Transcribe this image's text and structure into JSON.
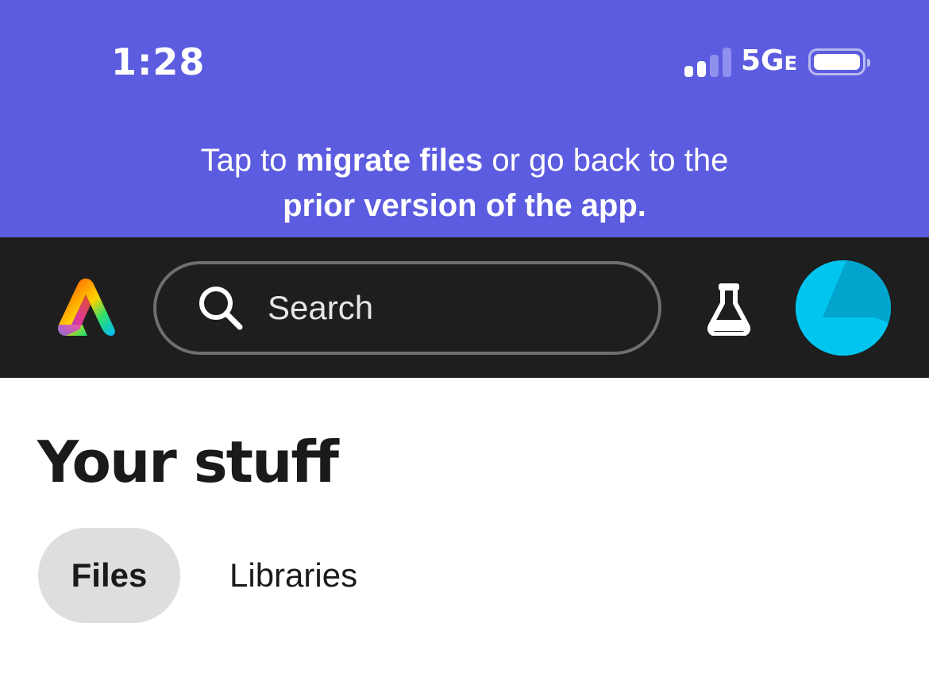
{
  "status_bar": {
    "time": "1:28",
    "network": "5G",
    "network_suffix": "E",
    "signal_bars": 4,
    "signal_bars_active": 2
  },
  "banner": {
    "text_1": "Tap to ",
    "bold_1": "migrate files",
    "text_2": " or go back to the",
    "bold_2": "prior version of the app",
    "text_3": ".",
    "background_color": "#5c5ce0"
  },
  "header": {
    "logo_icon": "adobe-express-logo",
    "search": {
      "placeholder": "Search",
      "icon": "search-icon"
    },
    "labs_icon": "flask-icon",
    "avatar_color": "#00c6ef",
    "background_color": "#1e1e1e"
  },
  "main": {
    "title": "Your stuff",
    "tabs": [
      {
        "label": "Files",
        "active": true
      },
      {
        "label": "Libraries",
        "active": false
      }
    ]
  }
}
